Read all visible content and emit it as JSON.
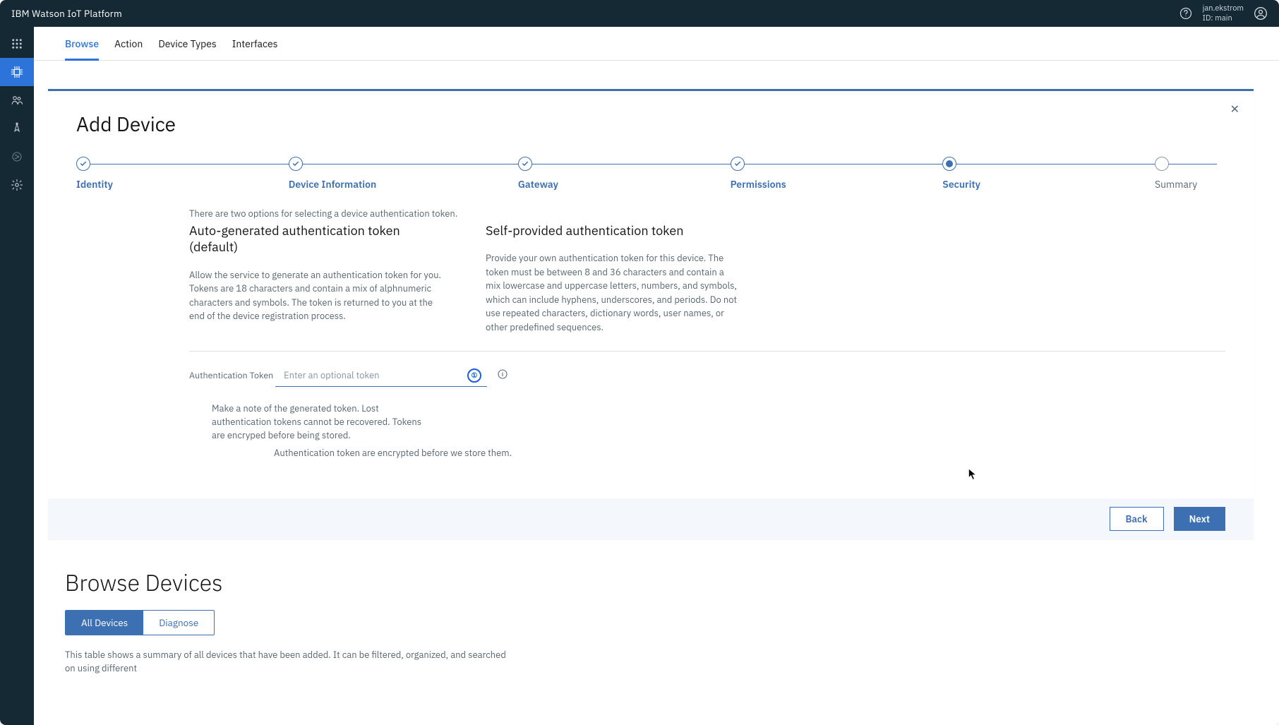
{
  "header": {
    "product": "IBM Watson IoT Platform",
    "user_name": "jan.ekstrom",
    "user_id": "ID: main"
  },
  "subnav": {
    "tabs": [
      "Browse",
      "Action",
      "Device Types",
      "Interfaces"
    ],
    "active": 0
  },
  "modal": {
    "title": "Add Device",
    "intro": "There are two options for selecting a device authentication token.",
    "steps": [
      {
        "label": "Identity",
        "state": "done"
      },
      {
        "label": "Device Information",
        "state": "done"
      },
      {
        "label": "Gateway",
        "state": "done"
      },
      {
        "label": "Permissions",
        "state": "done"
      },
      {
        "label": "Security",
        "state": "current"
      },
      {
        "label": "Summary",
        "state": "future"
      }
    ],
    "col_left": {
      "heading": "Auto-generated authentication token (default)",
      "body": "Allow the service to generate an authentication token for you. Tokens are 18 characters and contain a mix of alphnumeric characters and symbols. The token is returned to you at the end of the device registration process."
    },
    "col_right": {
      "heading": "Self-provided authentication token",
      "body": "Provide your own authentication token for this device. The token must be between 8 and 36 characters and contain a mix lowercase and uppercase letters, numbers, and symbols, which can include hyphens, underscores, and periods. Do not use repeated characters, dictionary words, user names, or other predefined sequences."
    },
    "token_label": "Authentication Token",
    "token_placeholder": "Enter an optional token",
    "token_value": "",
    "note": "Make a note of the generated token. Lost authentication tokens cannot be recovered. Tokens are encryped before being stored.",
    "encrypt_note": "Authentication token are encrypted before we store them.",
    "btn_back": "Back",
    "btn_next": "Next"
  },
  "browse": {
    "title": "Browse Devices",
    "segments": [
      "All Devices",
      "Diagnose"
    ],
    "active": 0,
    "desc": "This table shows a summary of all devices that have been added. It can be filtered, organized, and searched on using different"
  }
}
